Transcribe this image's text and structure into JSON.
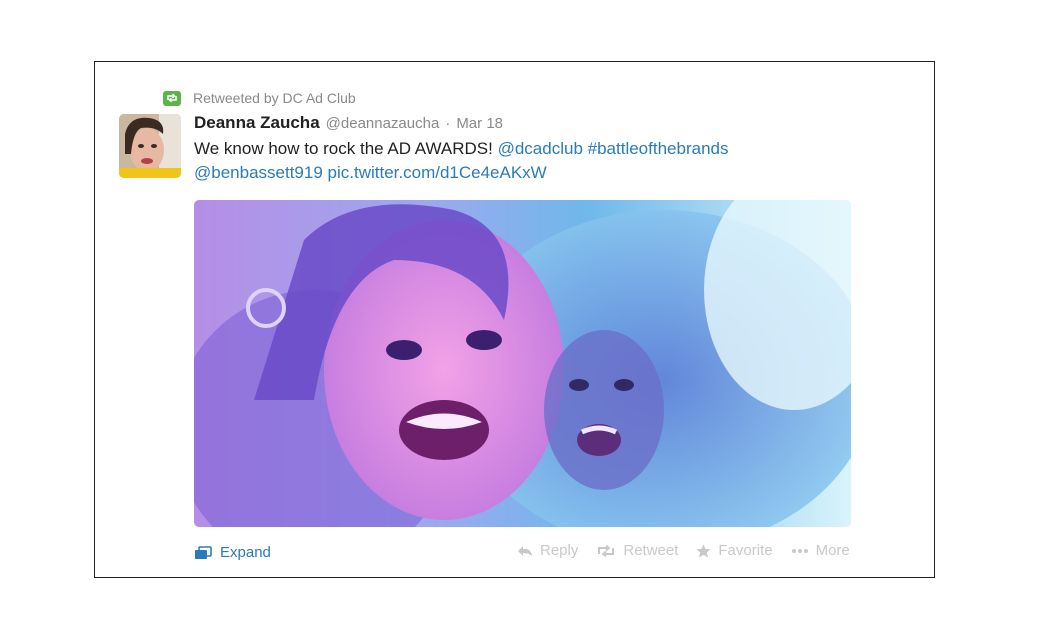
{
  "retweet": {
    "icon": "retweet-icon",
    "text": "Retweeted by DC Ad Club",
    "color": "#5fb34d"
  },
  "tweet": {
    "author_name": "Deanna Zaucha",
    "handle": "@deannazaucha",
    "separator": "·",
    "date": "Mar 18",
    "text_plain": "We know how to rock the AD AWARDS! ",
    "mention_1": "@dcadclub",
    "hashtag": "#battleofthebrands",
    "mention_2": "@benbassett919",
    "pic_link": "pic.twitter.com/d1Ce4eAKxW",
    "link_color": "#2b7bb9"
  },
  "actions": {
    "expand": {
      "label": "Expand",
      "icon": "expand-icon"
    },
    "reply": {
      "label": "Reply",
      "icon": "reply-icon"
    },
    "retweet": {
      "label": "Retweet",
      "icon": "retweet-icon"
    },
    "favorite": {
      "label": "Favorite",
      "icon": "star-icon"
    },
    "more": {
      "label": "More",
      "icon": "ellipsis-icon"
    }
  }
}
